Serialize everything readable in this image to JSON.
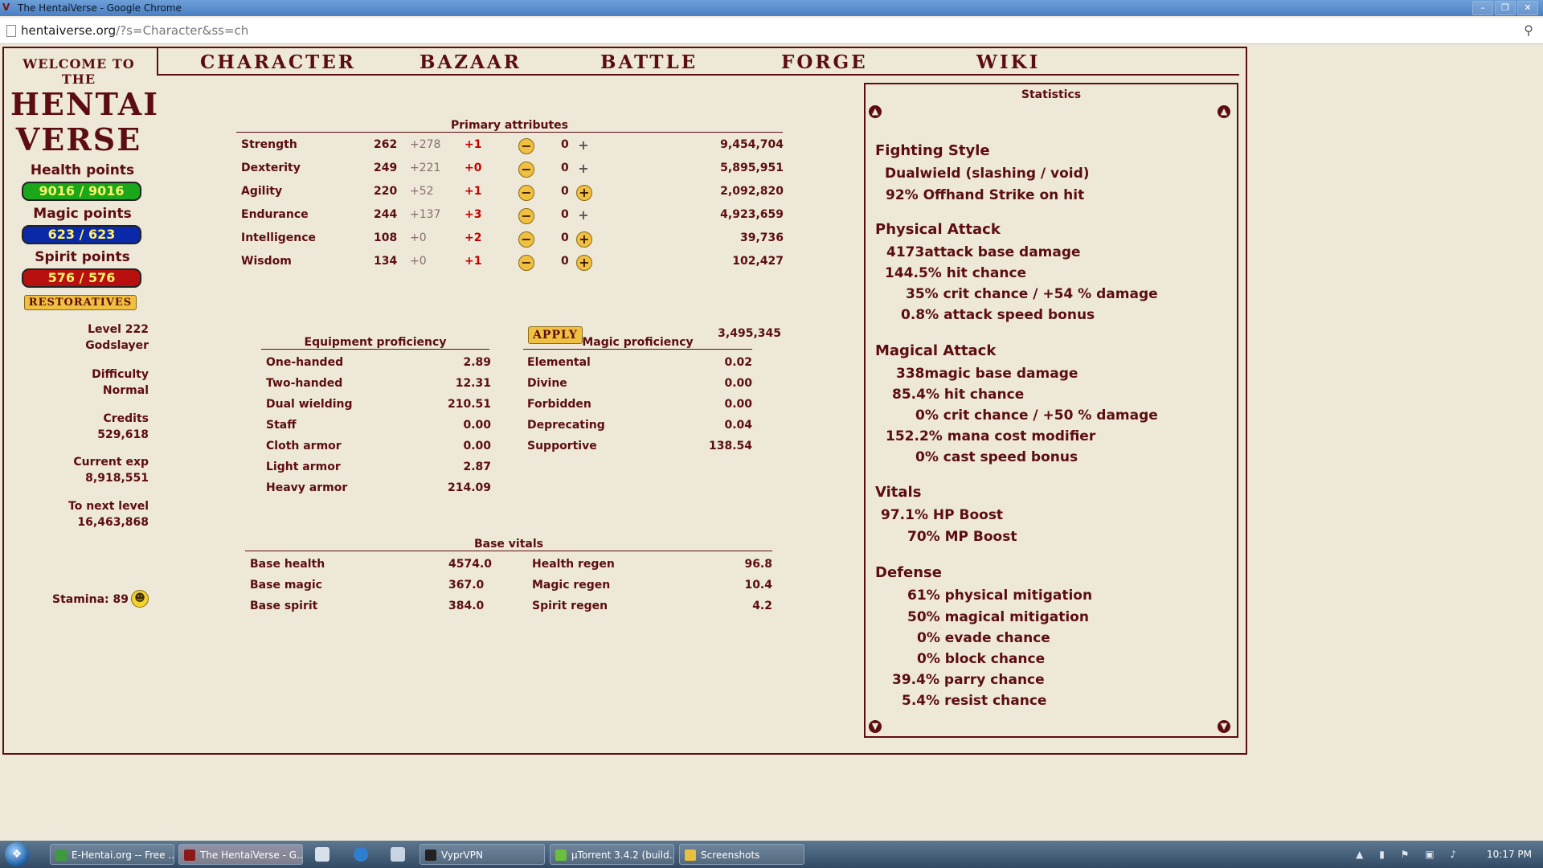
{
  "browser": {
    "window_title": "The HentaiVerse - Google Chrome",
    "url_host": "hentaiverse.org",
    "url_path": "/?s=Character&ss=ch"
  },
  "nav": [
    "CHARACTER",
    "BAZAAR",
    "BATTLE",
    "FORGE",
    "WIKI"
  ],
  "logo": {
    "welcome": "WELCOME TO THE",
    "line1": "HENTAI",
    "line2": "VERSE"
  },
  "vitals": {
    "health_label": "Health points",
    "health_value": "9016 / 9016",
    "magic_label": "Magic points",
    "magic_value": "623 / 623",
    "spirit_label": "Spirit points",
    "spirit_value": "576 / 576",
    "restoratives": "RESTORATIVES"
  },
  "character": {
    "level": "Level 222",
    "title": "Godslayer",
    "difficulty_label": "Difficulty",
    "difficulty": "Normal",
    "credits_label": "Credits",
    "credits": "529,618",
    "exp_label": "Current exp",
    "exp": "8,918,551",
    "next_label": "To next level",
    "next": "16,463,868",
    "stamina": "Stamina: 89"
  },
  "primary": {
    "title": "Primary attributes",
    "rows": [
      {
        "name": "Strength",
        "base": "262",
        "bonus": "+278",
        "mod": "+1",
        "assign": "0",
        "cost": "9,454,704",
        "plus_active": false
      },
      {
        "name": "Dexterity",
        "base": "249",
        "bonus": "+221",
        "mod": "+0",
        "assign": "0",
        "cost": "5,895,951",
        "plus_active": false
      },
      {
        "name": "Agility",
        "base": "220",
        "bonus": "+52",
        "mod": "+1",
        "assign": "0",
        "cost": "2,092,820",
        "plus_active": true
      },
      {
        "name": "Endurance",
        "base": "244",
        "bonus": "+137",
        "mod": "+3",
        "assign": "0",
        "cost": "4,923,659",
        "plus_active": false
      },
      {
        "name": "Intelligence",
        "base": "108",
        "bonus": "+0",
        "mod": "+2",
        "assign": "0",
        "cost": "39,736",
        "plus_active": true
      },
      {
        "name": "Wisdom",
        "base": "134",
        "bonus": "+0",
        "mod": "+1",
        "assign": "0",
        "cost": "102,427",
        "plus_active": true
      }
    ],
    "apply": "APPLY",
    "total": "3,495,345"
  },
  "equipment": {
    "title": "Equipment proficiency",
    "rows": [
      {
        "name": "One-handed",
        "value": "2.89"
      },
      {
        "name": "Two-handed",
        "value": "12.31"
      },
      {
        "name": "Dual wielding",
        "value": "210.51"
      },
      {
        "name": "Staff",
        "value": "0.00"
      },
      {
        "name": "Cloth armor",
        "value": "0.00"
      },
      {
        "name": "Light armor",
        "value": "2.87"
      },
      {
        "name": "Heavy armor",
        "value": "214.09"
      }
    ]
  },
  "magic": {
    "title": "Magic proficiency",
    "rows": [
      {
        "name": "Elemental",
        "value": "0.02"
      },
      {
        "name": "Divine",
        "value": "0.00"
      },
      {
        "name": "Forbidden",
        "value": "0.00"
      },
      {
        "name": "Deprecating",
        "value": "0.04"
      },
      {
        "name": "Supportive",
        "value": "138.54"
      }
    ]
  },
  "base_vitals": {
    "title": "Base vitals",
    "rows": [
      {
        "l_name": "Base health",
        "l_value": "4574.0",
        "r_name": "Health regen",
        "r_value": "96.8"
      },
      {
        "l_name": "Base magic",
        "l_value": "367.0",
        "r_name": "Magic regen",
        "r_value": "10.4"
      },
      {
        "l_name": "Base spirit",
        "l_value": "384.0",
        "r_name": "Spirit regen",
        "r_value": "4.2"
      }
    ]
  },
  "statistics": {
    "title": "Statistics",
    "fighting_style": {
      "head": "Fighting Style",
      "l1": "Dualwield (slashing / void)",
      "l2": "92% Offhand Strike on hit"
    },
    "physical": {
      "head": "Physical Attack",
      "l1": "4173attack base damage",
      "l2": "144.5% hit chance",
      "l3": "35% crit chance / +54 % damage",
      "l4": "0.8% attack speed bonus"
    },
    "magical": {
      "head": "Magical Attack",
      "l1": "338magic base damage",
      "l2": "85.4% hit chance",
      "l3": "0% crit chance / +50 % damage",
      "l4": "152.2% mana cost modifier",
      "l5": "0% cast speed bonus"
    },
    "vitals": {
      "head": "Vitals",
      "l1": "97.1% HP Boost",
      "l2": "70% MP Boost"
    },
    "defense": {
      "head": "Defense",
      "l1": "61% physical mitigation",
      "l2": "50% magical mitigation",
      "l3": "0% evade chance",
      "l4": "0% block chance",
      "l5": "39.4% parry chance",
      "l6": "5.4% resist chance"
    }
  },
  "taskbar": {
    "items": [
      "E-Hentai.org -- Free ...",
      "The HentaiVerse - G...",
      "VyprVPN",
      "µTorrent 3.4.2  (build...",
      "Screenshots"
    ],
    "clock": "10:17 PM"
  }
}
